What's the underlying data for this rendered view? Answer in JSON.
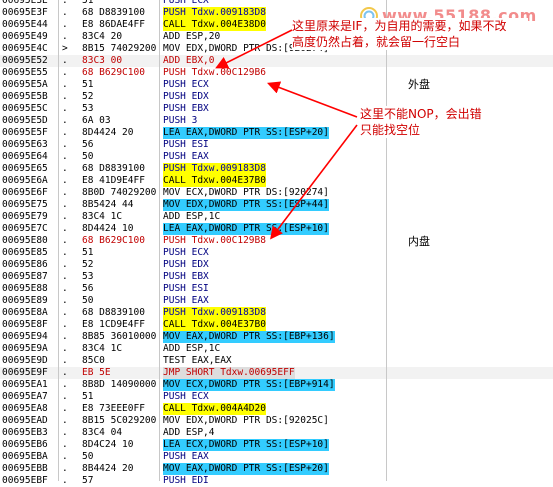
{
  "watermark": {
    "text": "www.55188.com"
  },
  "labels": {
    "outer": "外盘",
    "inner": "内盘"
  },
  "notes": {
    "top_line1": "这里原来是IF，为自用的需要，如果不改",
    "top_line2": "高度仍然占着，就会留一行空白",
    "mid_line1": "这里不能NOP，会出错",
    "mid_line2": "只能找空位"
  },
  "colors": {
    "red": "#c00000",
    "blue": "#0000a0",
    "yellow": "#ffff00",
    "cyan": "#33ccff",
    "arrow": "#ff0000"
  },
  "rows": [
    {
      "addr": "00695E3E",
      "mark": ".",
      "hex": "51",
      "asm": "PUSH ECX",
      "color": "navy"
    },
    {
      "addr": "00695E3F",
      "mark": ".",
      "hex": "68 D8839100",
      "asm": "PUSH Tdxw.009183D8",
      "color": "blue",
      "hl": "yellow"
    },
    {
      "addr": "00695E44",
      "mark": ".",
      "hex": "E8 86DAE4FF",
      "asm": "CALL Tdxw.004E38D0",
      "color": "black",
      "hl": "yellow"
    },
    {
      "addr": "00695E49",
      "mark": ".",
      "hex": "83C4 20",
      "asm": "ADD ESP,20",
      "color": "black"
    },
    {
      "addr": "00695E4C",
      "mark": ">",
      "hex": "8B15 74029200",
      "asm": "MOV EDX,DWORD PTR DS:[920274]",
      "color": "black"
    },
    {
      "addr": "00695E52",
      "mark": ".",
      "hex": "83C3 00",
      "asm": "ADD EBX,0",
      "color": "red",
      "sel": true
    },
    {
      "addr": "00695E55",
      "mark": ".",
      "hex": "68 B629C100",
      "asm": "PUSH Tdxw.00C129B6",
      "color": "red"
    },
    {
      "addr": "00695E5A",
      "mark": ".",
      "hex": "51",
      "asm": "PUSH ECX",
      "color": "navy"
    },
    {
      "addr": "00695E5B",
      "mark": ".",
      "hex": "52",
      "asm": "PUSH EDX",
      "color": "navy"
    },
    {
      "addr": "00695E5C",
      "mark": ".",
      "hex": "53",
      "asm": "PUSH EBX",
      "color": "navy"
    },
    {
      "addr": "00695E5D",
      "mark": ".",
      "hex": "6A 03",
      "asm": "PUSH 3",
      "color": "navy"
    },
    {
      "addr": "00695E5F",
      "mark": ".",
      "hex": "8D4424 20",
      "asm": "LEA EAX,DWORD PTR SS:[ESP+20]",
      "color": "black",
      "hl": "cyan"
    },
    {
      "addr": "00695E63",
      "mark": ".",
      "hex": "56",
      "asm": "PUSH ESI",
      "color": "navy"
    },
    {
      "addr": "00695E64",
      "mark": ".",
      "hex": "50",
      "asm": "PUSH EAX",
      "color": "navy"
    },
    {
      "addr": "00695E65",
      "mark": ".",
      "hex": "68 D8839100",
      "asm": "PUSH Tdxw.009183D8",
      "color": "blue",
      "hl": "yellow"
    },
    {
      "addr": "00695E6A",
      "mark": ".",
      "hex": "E8 41D9E4FF",
      "asm": "CALL Tdxw.004E37B0",
      "color": "black",
      "hl": "yellow"
    },
    {
      "addr": "00695E6F",
      "mark": ".",
      "hex": "8B0D 74029200",
      "asm": "MOV ECX,DWORD PTR DS:[920274]",
      "color": "black"
    },
    {
      "addr": "00695E75",
      "mark": ".",
      "hex": "8B5424 44",
      "asm": "MOV EDX,DWORD PTR SS:[ESP+44]",
      "color": "black",
      "hl": "cyan"
    },
    {
      "addr": "00695E79",
      "mark": ".",
      "hex": "83C4 1C",
      "asm": "ADD ESP,1C",
      "color": "black"
    },
    {
      "addr": "00695E7C",
      "mark": ".",
      "hex": "8D4424 10",
      "asm": "LEA EAX,DWORD PTR SS:[ESP+10]",
      "color": "black",
      "hl": "cyan"
    },
    {
      "addr": "00695E80",
      "mark": ".",
      "hex": "68 B629C100",
      "asm": "PUSH Tdxw.00C129B8",
      "color": "red"
    },
    {
      "addr": "00695E85",
      "mark": ".",
      "hex": "51",
      "asm": "PUSH ECX",
      "color": "navy"
    },
    {
      "addr": "00695E86",
      "mark": ".",
      "hex": "52",
      "asm": "PUSH EDX",
      "color": "navy"
    },
    {
      "addr": "00695E87",
      "mark": ".",
      "hex": "53",
      "asm": "PUSH EBX",
      "color": "navy"
    },
    {
      "addr": "00695E88",
      "mark": ".",
      "hex": "56",
      "asm": "PUSH ESI",
      "color": "navy"
    },
    {
      "addr": "00695E89",
      "mark": ".",
      "hex": "50",
      "asm": "PUSH EAX",
      "color": "navy"
    },
    {
      "addr": "00695E8A",
      "mark": ".",
      "hex": "68 D8839100",
      "asm": "PUSH Tdxw.009183D8",
      "color": "blue",
      "hl": "yellow"
    },
    {
      "addr": "00695E8F",
      "mark": ".",
      "hex": "E8 1CD9E4FF",
      "asm": "CALL Tdxw.004E37B0",
      "color": "black",
      "hl": "yellow"
    },
    {
      "addr": "00695E94",
      "mark": ".",
      "hex": "8B85 36010000",
      "asm": "MOV EAX,DWORD PTR SS:[EBP+136]",
      "color": "black",
      "hl": "cyan"
    },
    {
      "addr": "00695E9A",
      "mark": ".",
      "hex": "83C4 1C",
      "asm": "ADD ESP,1C",
      "color": "black"
    },
    {
      "addr": "00695E9D",
      "mark": ".",
      "hex": "85C0",
      "asm": "TEST EAX,EAX",
      "color": "black"
    },
    {
      "addr": "00695E9F",
      "mark": ".",
      "hex": "EB 5E",
      "asm": "JMP SHORT Tdxw.00695EFF",
      "color": "red",
      "hl": "gray",
      "sel": true
    },
    {
      "addr": "00695EA1",
      "mark": ".",
      "hex": "8B8D 14090000",
      "asm": "MOV ECX,DWORD PTR SS:[EBP+914]",
      "color": "black",
      "hl": "cyan"
    },
    {
      "addr": "00695EA7",
      "mark": ".",
      "hex": "51",
      "asm": "PUSH ECX",
      "color": "navy"
    },
    {
      "addr": "00695EA8",
      "mark": ".",
      "hex": "E8 73EEE0FF",
      "asm": "CALL Tdxw.004A4D20",
      "color": "black",
      "hl": "yellow"
    },
    {
      "addr": "00695EAD",
      "mark": ".",
      "hex": "8B15 5C029200",
      "asm": "MOV EDX,DWORD PTR DS:[92025C]",
      "color": "black"
    },
    {
      "addr": "00695EB3",
      "mark": ".",
      "hex": "83C4 04",
      "asm": "ADD ESP,4",
      "color": "black"
    },
    {
      "addr": "00695EB6",
      "mark": ".",
      "hex": "8D4C24 10",
      "asm": "LEA ECX,DWORD PTR SS:[ESP+10]",
      "color": "black",
      "hl": "cyan"
    },
    {
      "addr": "00695EBA",
      "mark": ".",
      "hex": "50",
      "asm": "PUSH EAX",
      "color": "navy"
    },
    {
      "addr": "00695EBB",
      "mark": ".",
      "hex": "8B4424 20",
      "asm": "MOV EAX,DWORD PTR SS:[ESP+20]",
      "color": "black",
      "hl": "cyan"
    },
    {
      "addr": "00695EBF",
      "mark": ".",
      "hex": "57",
      "asm": "PUSH EDI",
      "color": "navy"
    }
  ]
}
